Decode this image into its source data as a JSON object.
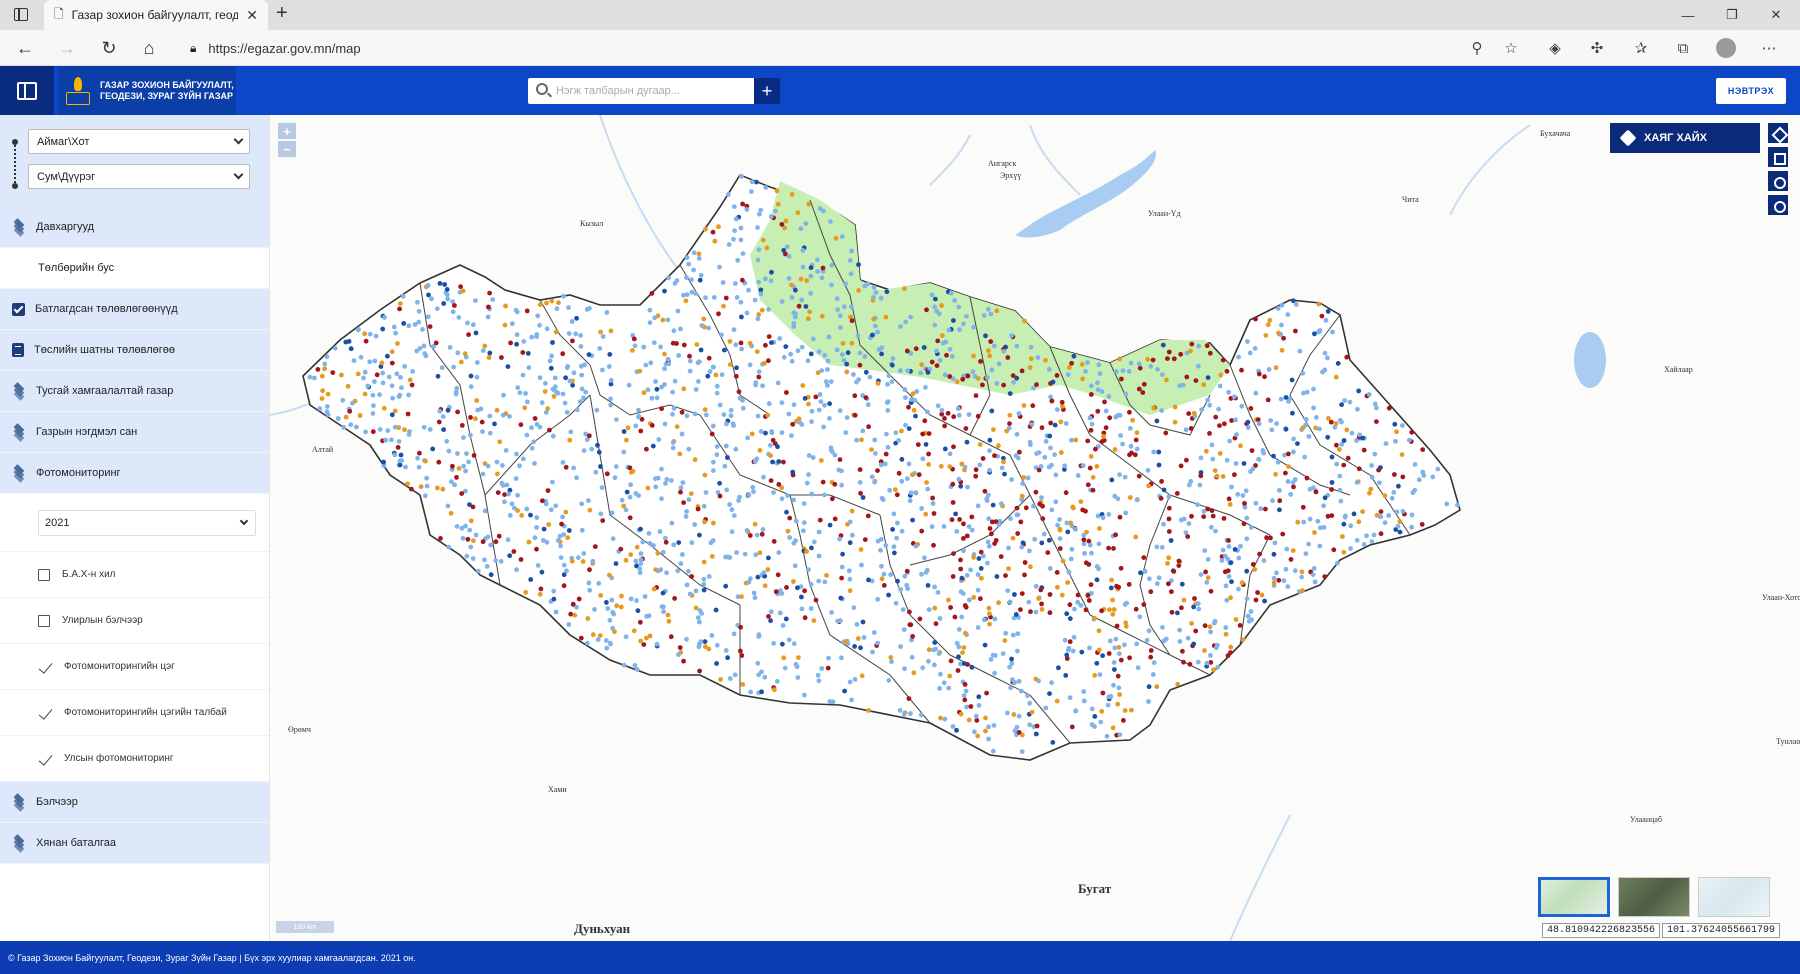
{
  "browser": {
    "tab_title": "Газар зохион байгуулалт, геоде",
    "url": "https://egazar.gov.mn/map",
    "new_tab": "+",
    "close": "✕",
    "window_controls": [
      "—",
      "❐",
      "✕"
    ]
  },
  "header": {
    "logo_line1": "ГАЗАР ЗОХИОН БАЙГУУЛАЛТ,",
    "logo_line2": "ГЕОДЕЗИ, ЗУРАГ ЗҮЙН ГАЗАР",
    "search_placeholder": "Нэгж талбарын дугаар...",
    "add_label": "+",
    "login_label": "НЭВТРЭХ"
  },
  "filters": {
    "aimag": "Аймаг\\Хот",
    "sum": "Сум\\Дүүрэг"
  },
  "menu": {
    "layers": "Давхаргууд",
    "free": "Төлбөрийн бус",
    "approved_plans": "Батлагдсан төлөвлөгөөнүүд",
    "draft_plan": "Төслийн шатны төлөвлөгөө",
    "protected": "Тусгай хамгаалалтай газар",
    "land_fund": "Газрын нэгдмэл сан",
    "photomonitoring": "Фотомониторинг",
    "year": "2021",
    "sub_items": [
      {
        "label": "Б.А.Х-н хил",
        "state": "checkbox"
      },
      {
        "label": "Улирлын бэлчээр",
        "state": "checkbox"
      },
      {
        "label": "Фотомониторингийн цэг",
        "state": "tick"
      },
      {
        "label": "Фотомониторингийн цэгийн талбай",
        "state": "tick"
      },
      {
        "label": "Улсын фотомониторинг",
        "state": "tick"
      }
    ],
    "pasture": "Бэлчээр",
    "quality": "Хянан баталгаа"
  },
  "map": {
    "address_search": "ХАЯГ ХАЙХ",
    "zoom_in": "+",
    "zoom_out": "−",
    "scale_label": "100 km",
    "lat": "48.810942226823556",
    "lon": "101.37624055661799",
    "places": [
      {
        "name": "Бухачача"
      },
      {
        "name": "Ангарск"
      },
      {
        "name": "Эрхүү"
      },
      {
        "name": "Улаан-Үд"
      },
      {
        "name": "Чита"
      },
      {
        "name": "Кызыл"
      },
      {
        "name": "Хайлаар"
      },
      {
        "name": "Алтай"
      },
      {
        "name": "Улаан-Хото"
      },
      {
        "name": "Өрөмч"
      },
      {
        "name": "Хами"
      },
      {
        "name": "Тунлао"
      },
      {
        "name": "Улаанцаб"
      },
      {
        "name": "Бугат"
      },
      {
        "name": "Дуньхуан"
      }
    ],
    "dot_colors": {
      "light_blue": "#7fb3ea",
      "dark_blue": "#1b4fa6",
      "orange": "#e69a1e",
      "dark_red": "#a3161b"
    },
    "forest_color": "#c8efb3",
    "water_color": "#a9cdf2"
  },
  "footer": {
    "text": "© Газар Зохион Байгуулалт, Геодези, Зураг Зүйн Газар | Бүх эрх хуулиар хамгаалагдсан. 2021 он."
  }
}
